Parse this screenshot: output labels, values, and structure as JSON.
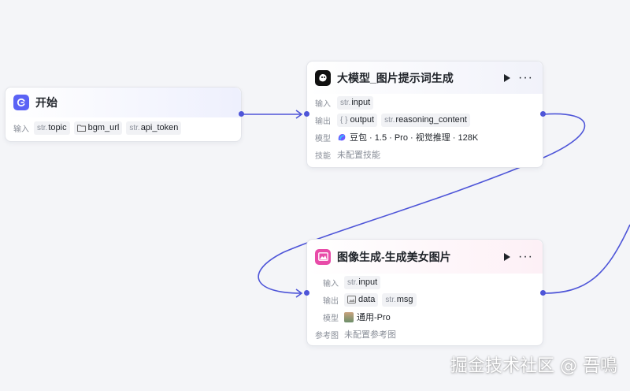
{
  "colors": {
    "edge": "#4e55d8",
    "start_icon": "#5b63f5",
    "llm_icon": "#111111",
    "image_icon": "#e84ba8"
  },
  "start_node": {
    "title": "开始",
    "input_label": "输入",
    "inputs": [
      {
        "type": "str.",
        "name": "topic",
        "icon": ""
      },
      {
        "type": "",
        "name": "bgm_url",
        "icon": "folder-icon"
      },
      {
        "type": "str.",
        "name": "api_token",
        "icon": ""
      }
    ]
  },
  "llm_node": {
    "title": "大模型_图片提示词生成",
    "input_label": "输入",
    "input": {
      "type": "str.",
      "name": "input"
    },
    "output_label": "输出",
    "outputs": [
      {
        "type": "{ }",
        "name": "output"
      },
      {
        "type": "str.",
        "name": "reasoning_content"
      }
    ],
    "model_label": "模型",
    "model": "豆包 · 1.5 · Pro · 视觉推理 · 128K",
    "skill_label": "技能",
    "skill_value": "未配置技能"
  },
  "image_node": {
    "title": "图像生成-生成美女图片",
    "input_label": "输入",
    "input": {
      "type": "str.",
      "name": "input"
    },
    "output_label": "输出",
    "outputs": [
      {
        "type": "",
        "name": "data",
        "icon": "image-icon"
      },
      {
        "type": "str.",
        "name": "msg"
      }
    ],
    "model_label": "模型",
    "model": "通用-Pro",
    "ref_label": "参考图",
    "ref_value": "未配置参考图"
  },
  "watermark": "掘金技术社区 @ 吾鳴"
}
